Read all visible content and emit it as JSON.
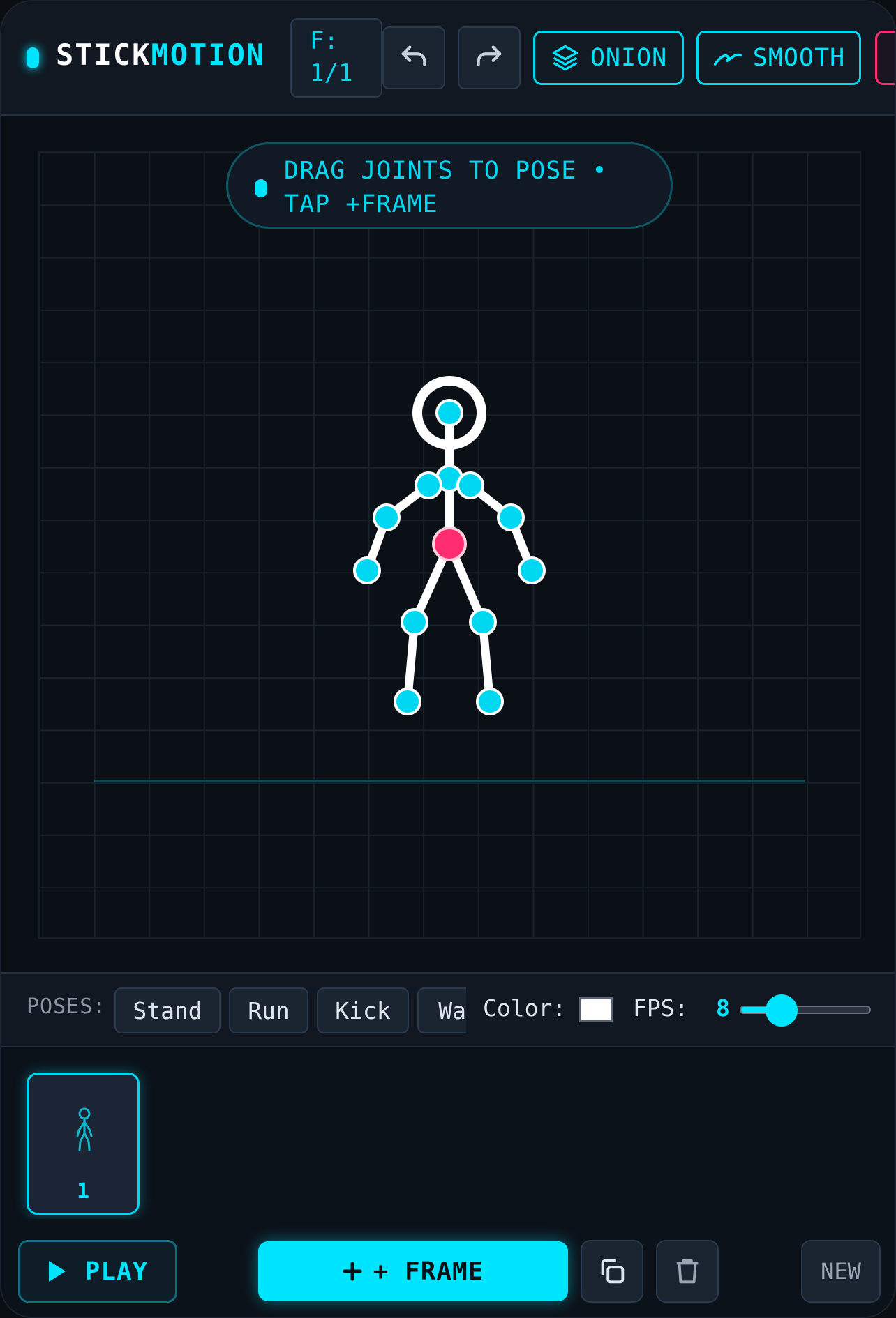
{
  "header": {
    "logo_part1": "STICK",
    "logo_part2": "MOTION",
    "frame_indicator": "F: 1/1",
    "undo_icon": "undo-icon",
    "redo_icon": "redo-icon",
    "onion_label": "ONION",
    "onion_icon": "layers-icon",
    "smooth_label": "SMOOTH",
    "smooth_icon": "smooth-curve-icon"
  },
  "canvas": {
    "hint": "DRAG JOINTS TO POSE • TAP +FRAME",
    "joint_color": "#00d7f0",
    "root_joint_color": "#ff2d6f",
    "bone_color": "#ffffff"
  },
  "poses_bar": {
    "label": "POSES:",
    "poses": [
      "Stand",
      "Run",
      "Kick",
      "Wave"
    ],
    "color_label": "Color:",
    "selected_color": "#ffffff",
    "fps_label": "FPS:",
    "fps_value": "8",
    "fps_level": 0.32
  },
  "timeline": {
    "frames": [
      {
        "number": "1"
      }
    ]
  },
  "bottom": {
    "play_label": "PLAY",
    "add_frame_label": "+ FRAME",
    "duplicate_icon": "copy-icon",
    "delete_icon": "trash-icon",
    "new_label": "NEW"
  },
  "colors": {
    "accent": "#00e5ff",
    "danger": "#ff2d6f",
    "background": "#0c1016"
  }
}
